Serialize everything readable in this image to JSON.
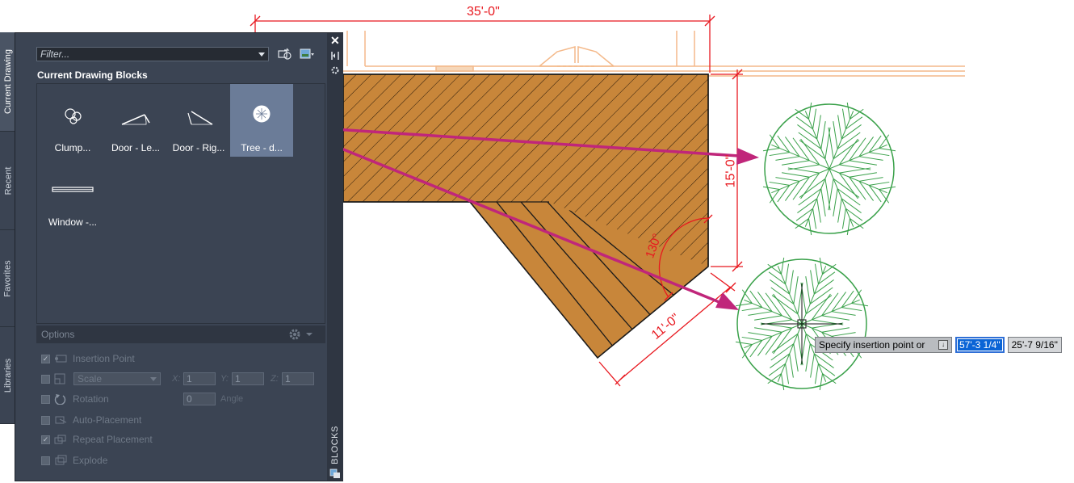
{
  "drawing": {
    "dimensions": {
      "width_top": "35'-0\"",
      "height_right": "15'-0\"",
      "angle": "130°",
      "diagonal": "11'-0\""
    },
    "colors": {
      "deck_fill": "#c8863a",
      "outline": "#1a1a1a",
      "dimension": "#e8181f",
      "house": "#f4b98a",
      "tree": "#3aa14a",
      "arrow": "#c0267a"
    }
  },
  "palette": {
    "title": "BLOCKS",
    "side_tabs": [
      "Current Drawing",
      "Recent",
      "Favorites",
      "Libraries"
    ],
    "filter_placeholder": "Filter...",
    "section_title": "Current Drawing Blocks",
    "blocks": [
      {
        "label": "Clump...",
        "icon": "clump-icon"
      },
      {
        "label": "Door - Le...",
        "icon": "door-left-icon"
      },
      {
        "label": "Door - Rig...",
        "icon": "door-right-icon"
      },
      {
        "label": "Tree - d...",
        "icon": "tree-icon",
        "selected": true
      },
      {
        "label": "Window -...",
        "icon": "window-icon"
      }
    ],
    "options": {
      "title": "Options",
      "insertion_point": "Insertion Point",
      "scale_select": "Scale",
      "x_label": "X:",
      "x_value": "1",
      "y_label": "Y:",
      "y_value": "1",
      "z_label": "Z:",
      "z_value": "1",
      "rotation": "Rotation",
      "rotation_value": "0",
      "angle_label": "Angle",
      "auto_placement": "Auto-Placement",
      "repeat_placement": "Repeat Placement",
      "explode": "Explode",
      "insertion_point_checked": true,
      "repeat_placement_checked": true
    }
  },
  "tooltip": {
    "prompt": "Specify insertion point or",
    "x_value": "57'-3 1/4\"",
    "y_value": "25'-7 9/16\""
  }
}
